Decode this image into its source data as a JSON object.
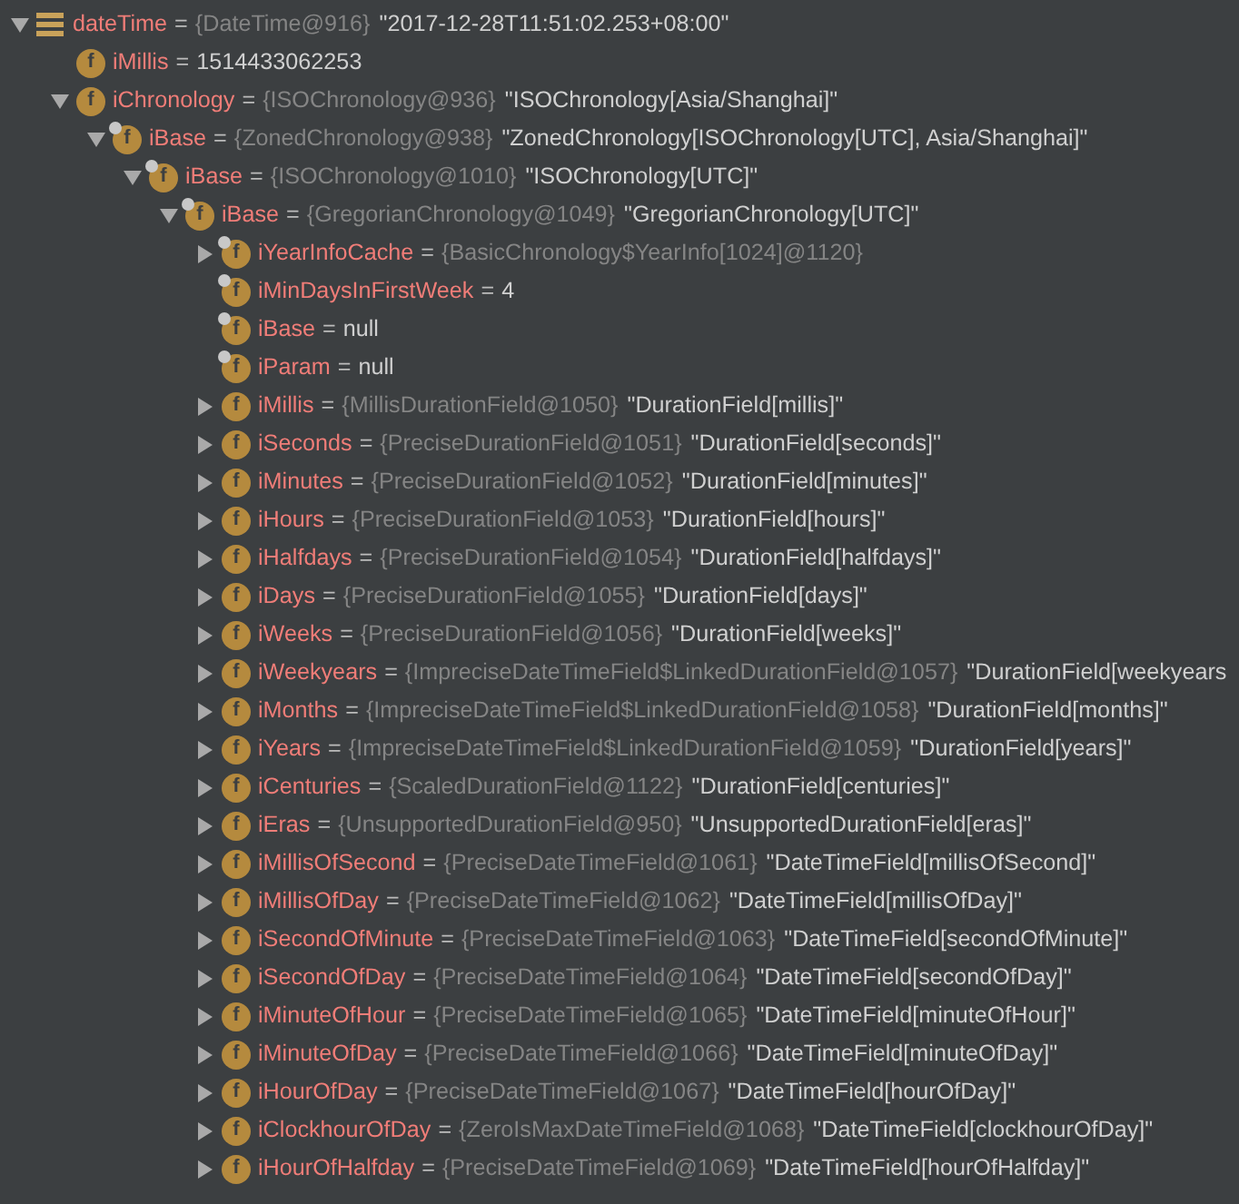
{
  "variables": [
    {
      "kind": "local",
      "name": "dateTime",
      "equals": "=",
      "type": "{DateTime@916}",
      "value": "\"2017-12-28T11:51:02.253+08:00\"",
      "expanded": true,
      "children": [
        {
          "kind": "field",
          "badge": "f",
          "final": false,
          "name": "iMillis",
          "equals": "=",
          "value": "1514433062253"
        },
        {
          "kind": "field",
          "badge": "f",
          "final": false,
          "name": "iChronology",
          "equals": "=",
          "type": "{ISOChronology@936}",
          "value": "\"ISOChronology[Asia/Shanghai]\"",
          "expanded": true,
          "children": [
            {
              "kind": "field",
              "badge": "f",
              "final": true,
              "name": "iBase",
              "equals": "=",
              "type": "{ZonedChronology@938}",
              "value": "\"ZonedChronology[ISOChronology[UTC], Asia/Shanghai]\"",
              "expanded": true,
              "children": [
                {
                  "kind": "field",
                  "badge": "f",
                  "final": true,
                  "name": "iBase",
                  "equals": "=",
                  "type": "{ISOChronology@1010}",
                  "value": "\"ISOChronology[UTC]\"",
                  "expanded": true,
                  "children": [
                    {
                      "kind": "field",
                      "badge": "f",
                      "final": true,
                      "name": "iBase",
                      "equals": "=",
                      "type": "{GregorianChronology@1049}",
                      "value": "\"GregorianChronology[UTC]\"",
                      "expanded": true,
                      "children": [
                        {
                          "kind": "field",
                          "badge": "f",
                          "final": true,
                          "name": "iYearInfoCache",
                          "equals": "=",
                          "type": "{BasicChronology$YearInfo[1024]@1120}",
                          "expanded": false
                        },
                        {
                          "kind": "field",
                          "badge": "f",
                          "final": true,
                          "name": "iMinDaysInFirstWeek",
                          "equals": "=",
                          "value": "4"
                        },
                        {
                          "kind": "field",
                          "badge": "f",
                          "final": true,
                          "name": "iBase",
                          "equals": "=",
                          "value": "null"
                        },
                        {
                          "kind": "field",
                          "badge": "f",
                          "final": true,
                          "name": "iParam",
                          "equals": "=",
                          "value": "null"
                        },
                        {
                          "kind": "field",
                          "badge": "f",
                          "final": false,
                          "name": "iMillis",
                          "equals": "=",
                          "type": "{MillisDurationField@1050}",
                          "value": "\"DurationField[millis]\"",
                          "expanded": false
                        },
                        {
                          "kind": "field",
                          "badge": "f",
                          "final": false,
                          "name": "iSeconds",
                          "equals": "=",
                          "type": "{PreciseDurationField@1051}",
                          "value": "\"DurationField[seconds]\"",
                          "expanded": false
                        },
                        {
                          "kind": "field",
                          "badge": "f",
                          "final": false,
                          "name": "iMinutes",
                          "equals": "=",
                          "type": "{PreciseDurationField@1052}",
                          "value": "\"DurationField[minutes]\"",
                          "expanded": false
                        },
                        {
                          "kind": "field",
                          "badge": "f",
                          "final": false,
                          "name": "iHours",
                          "equals": "=",
                          "type": "{PreciseDurationField@1053}",
                          "value": "\"DurationField[hours]\"",
                          "expanded": false
                        },
                        {
                          "kind": "field",
                          "badge": "f",
                          "final": false,
                          "name": "iHalfdays",
                          "equals": "=",
                          "type": "{PreciseDurationField@1054}",
                          "value": "\"DurationField[halfdays]\"",
                          "expanded": false
                        },
                        {
                          "kind": "field",
                          "badge": "f",
                          "final": false,
                          "name": "iDays",
                          "equals": "=",
                          "type": "{PreciseDurationField@1055}",
                          "value": "\"DurationField[days]\"",
                          "expanded": false
                        },
                        {
                          "kind": "field",
                          "badge": "f",
                          "final": false,
                          "name": "iWeeks",
                          "equals": "=",
                          "type": "{PreciseDurationField@1056}",
                          "value": "\"DurationField[weeks]\"",
                          "expanded": false
                        },
                        {
                          "kind": "field",
                          "badge": "f",
                          "final": false,
                          "name": "iWeekyears",
                          "equals": "=",
                          "type": "{ImpreciseDateTimeField$LinkedDurationField@1057}",
                          "value": "\"DurationField[weekyears",
                          "expanded": false
                        },
                        {
                          "kind": "field",
                          "badge": "f",
                          "final": false,
                          "name": "iMonths",
                          "equals": "=",
                          "type": "{ImpreciseDateTimeField$LinkedDurationField@1058}",
                          "value": "\"DurationField[months]\"",
                          "expanded": false
                        },
                        {
                          "kind": "field",
                          "badge": "f",
                          "final": false,
                          "name": "iYears",
                          "equals": "=",
                          "type": "{ImpreciseDateTimeField$LinkedDurationField@1059}",
                          "value": "\"DurationField[years]\"",
                          "expanded": false
                        },
                        {
                          "kind": "field",
                          "badge": "f",
                          "final": false,
                          "name": "iCenturies",
                          "equals": "=",
                          "type": "{ScaledDurationField@1122}",
                          "value": "\"DurationField[centuries]\"",
                          "expanded": false
                        },
                        {
                          "kind": "field",
                          "badge": "f",
                          "final": false,
                          "name": "iEras",
                          "equals": "=",
                          "type": "{UnsupportedDurationField@950}",
                          "value": "\"UnsupportedDurationField[eras]\"",
                          "expanded": false
                        },
                        {
                          "kind": "field",
                          "badge": "f",
                          "final": false,
                          "name": "iMillisOfSecond",
                          "equals": "=",
                          "type": "{PreciseDateTimeField@1061}",
                          "value": "\"DateTimeField[millisOfSecond]\"",
                          "expanded": false
                        },
                        {
                          "kind": "field",
                          "badge": "f",
                          "final": false,
                          "name": "iMillisOfDay",
                          "equals": "=",
                          "type": "{PreciseDateTimeField@1062}",
                          "value": "\"DateTimeField[millisOfDay]\"",
                          "expanded": false
                        },
                        {
                          "kind": "field",
                          "badge": "f",
                          "final": false,
                          "name": "iSecondOfMinute",
                          "equals": "=",
                          "type": "{PreciseDateTimeField@1063}",
                          "value": "\"DateTimeField[secondOfMinute]\"",
                          "expanded": false
                        },
                        {
                          "kind": "field",
                          "badge": "f",
                          "final": false,
                          "name": "iSecondOfDay",
                          "equals": "=",
                          "type": "{PreciseDateTimeField@1064}",
                          "value": "\"DateTimeField[secondOfDay]\"",
                          "expanded": false
                        },
                        {
                          "kind": "field",
                          "badge": "f",
                          "final": false,
                          "name": "iMinuteOfHour",
                          "equals": "=",
                          "type": "{PreciseDateTimeField@1065}",
                          "value": "\"DateTimeField[minuteOfHour]\"",
                          "expanded": false
                        },
                        {
                          "kind": "field",
                          "badge": "f",
                          "final": false,
                          "name": "iMinuteOfDay",
                          "equals": "=",
                          "type": "{PreciseDateTimeField@1066}",
                          "value": "\"DateTimeField[minuteOfDay]\"",
                          "expanded": false
                        },
                        {
                          "kind": "field",
                          "badge": "f",
                          "final": false,
                          "name": "iHourOfDay",
                          "equals": "=",
                          "type": "{PreciseDateTimeField@1067}",
                          "value": "\"DateTimeField[hourOfDay]\"",
                          "expanded": false
                        },
                        {
                          "kind": "field",
                          "badge": "f",
                          "final": false,
                          "name": "iClockhourOfDay",
                          "equals": "=",
                          "type": "{ZeroIsMaxDateTimeField@1068}",
                          "value": "\"DateTimeField[clockhourOfDay]\"",
                          "expanded": false
                        },
                        {
                          "kind": "field",
                          "badge": "f",
                          "final": false,
                          "name": "iHourOfHalfday",
                          "equals": "=",
                          "type": "{PreciseDateTimeField@1069}",
                          "value": "\"DateTimeField[hourOfHalfday]\"",
                          "expanded": false
                        }
                      ]
                    }
                  ]
                }
              ]
            }
          ]
        }
      ]
    }
  ]
}
